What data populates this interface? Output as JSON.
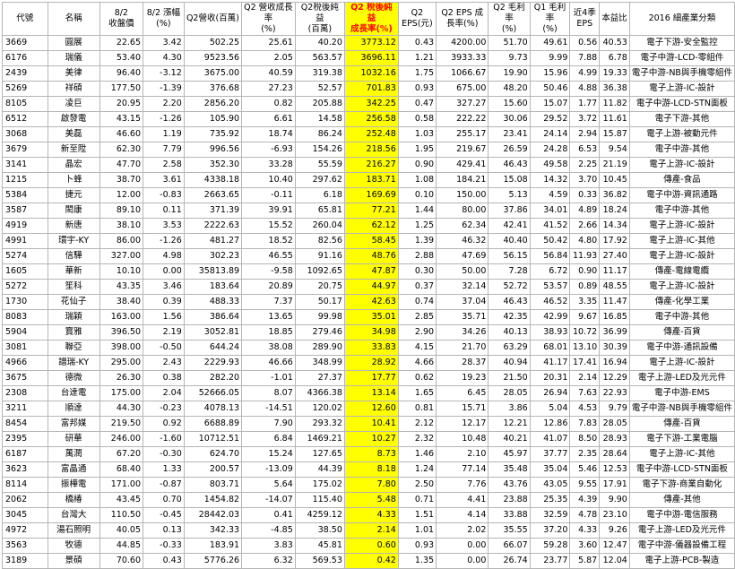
{
  "table": {
    "headers": [
      "代號",
      "名稱",
      "8/2\n收盤價",
      "8/2 漲幅\n(%)",
      "Q2營收(百萬)",
      "Q2 營收成長率\n(%)",
      "Q2稅後純益\n(百萬)",
      "Q2 稅後純益\n成長率(%)",
      "Q2\nEPS(元)",
      "Q2 EPS 成\n長率(%)",
      "Q2 毛利率\n(%)",
      "Q1 毛利率\n(%)",
      "近4季\nEPS",
      "本益比",
      "2016 細產業分類"
    ],
    "rows": [
      [
        "3669",
        "圓展",
        "22.65",
        "3.42",
        "502.25",
        "25.61",
        "40.20",
        "3773.12",
        "0.43",
        "4200.00",
        "51.70",
        "49.61",
        "0.56",
        "40.53",
        "電子下游-安全監控"
      ],
      [
        "6176",
        "瑞儀",
        "53.40",
        "4.30",
        "9523.56",
        "2.05",
        "563.57",
        "3696.11",
        "1.21",
        "3933.33",
        "9.73",
        "9.99",
        "7.88",
        "6.78",
        "電子中游-LCD-零組件"
      ],
      [
        "2439",
        "美律",
        "96.40",
        "-3.12",
        "3675.00",
        "40.59",
        "319.38",
        "1032.16",
        "1.75",
        "1066.67",
        "19.90",
        "15.96",
        "4.99",
        "19.33",
        "電子中游-NB與手機零組件"
      ],
      [
        "5269",
        "祥碩",
        "177.50",
        "-1.39",
        "376.68",
        "27.23",
        "52.57",
        "701.83",
        "0.93",
        "675.00",
        "48.20",
        "50.46",
        "4.88",
        "36.38",
        "電子上游-IC-設計"
      ],
      [
        "8105",
        "凌巨",
        "20.95",
        "2.20",
        "2856.20",
        "0.82",
        "205.88",
        "342.25",
        "0.47",
        "327.27",
        "15.60",
        "15.07",
        "1.77",
        "11.82",
        "電子中游-LCD-STN面板"
      ],
      [
        "6512",
        "啟發電",
        "43.15",
        "-1.26",
        "105.90",
        "6.61",
        "14.58",
        "256.58",
        "0.58",
        "222.22",
        "30.06",
        "29.52",
        "3.72",
        "11.61",
        "電子下游-其他"
      ],
      [
        "3068",
        "美磊",
        "46.60",
        "1.19",
        "735.92",
        "18.74",
        "86.24",
        "252.48",
        "1.03",
        "255.17",
        "23.41",
        "24.14",
        "2.94",
        "15.87",
        "電子上游-被動元件"
      ],
      [
        "3679",
        "新至陞",
        "62.30",
        "7.79",
        "996.56",
        "-6.93",
        "154.26",
        "218.56",
        "1.95",
        "219.67",
        "26.59",
        "24.28",
        "6.53",
        "9.54",
        "電子中游-其他"
      ],
      [
        "3141",
        "晶宏",
        "47.70",
        "2.58",
        "352.30",
        "33.28",
        "55.59",
        "216.27",
        "0.90",
        "429.41",
        "46.43",
        "49.58",
        "2.25",
        "21.19",
        "電子上游-IC-設計"
      ],
      [
        "1215",
        "卜蜂",
        "38.70",
        "3.61",
        "4338.18",
        "10.40",
        "297.62",
        "183.71",
        "1.08",
        "184.21",
        "15.08",
        "14.32",
        "3.70",
        "10.45",
        "傳產-食品"
      ],
      [
        "5384",
        "捷元",
        "12.00",
        "-0.83",
        "2663.65",
        "-0.11",
        "6.18",
        "169.69",
        "0.10",
        "150.00",
        "5.13",
        "4.59",
        "0.33",
        "36.82",
        "電子中游-資訊通路"
      ],
      [
        "3587",
        "閎康",
        "89.10",
        "0.11",
        "371.39",
        "39.91",
        "65.81",
        "77.21",
        "1.44",
        "80.00",
        "37.86",
        "34.01",
        "4.89",
        "18.24",
        "電子中游-其他"
      ],
      [
        "4919",
        "新唐",
        "38.10",
        "3.53",
        "2222.63",
        "15.52",
        "260.04",
        "62.12",
        "1.25",
        "62.34",
        "42.41",
        "41.52",
        "2.66",
        "14.34",
        "電子上游-IC-設計"
      ],
      [
        "4991",
        "環宇-KY",
        "86.00",
        "-1.26",
        "481.27",
        "18.52",
        "82.56",
        "58.45",
        "1.39",
        "46.32",
        "40.40",
        "50.42",
        "4.80",
        "17.92",
        "電子上游-IC-其他"
      ],
      [
        "5274",
        "信驊",
        "327.00",
        "4.98",
        "302.23",
        "46.55",
        "91.16",
        "48.76",
        "2.88",
        "47.69",
        "56.15",
        "56.84",
        "11.93",
        "27.40",
        "電子上游-IC-設計"
      ],
      [
        "1605",
        "華新",
        "10.10",
        "0.00",
        "35813.89",
        "-9.58",
        "1092.65",
        "47.87",
        "0.30",
        "50.00",
        "7.28",
        "6.72",
        "0.90",
        "11.17",
        "傳產-電線電纜"
      ],
      [
        "5272",
        "笙科",
        "43.35",
        "3.46",
        "183.64",
        "20.89",
        "20.75",
        "44.97",
        "0.37",
        "32.14",
        "52.72",
        "53.57",
        "0.89",
        "48.55",
        "電子上游-IC-設計"
      ],
      [
        "1730",
        "花仙子",
        "38.40",
        "0.39",
        "488.33",
        "7.37",
        "50.17",
        "42.63",
        "0.74",
        "37.04",
        "46.43",
        "46.52",
        "3.35",
        "11.47",
        "傳產-化學工業"
      ],
      [
        "8083",
        "瑞穎",
        "163.00",
        "1.56",
        "386.64",
        "13.65",
        "99.98",
        "35.01",
        "2.85",
        "35.71",
        "42.35",
        "42.99",
        "9.67",
        "16.85",
        "電子中游-其他"
      ],
      [
        "5904",
        "寶雅",
        "396.50",
        "2.19",
        "3052.81",
        "18.85",
        "279.46",
        "34.98",
        "2.90",
        "34.26",
        "40.13",
        "38.93",
        "10.72",
        "36.99",
        "傳產-百貨"
      ],
      [
        "3081",
        "聯亞",
        "398.00",
        "-0.50",
        "644.24",
        "38.08",
        "289.90",
        "33.83",
        "4.15",
        "21.70",
        "63.29",
        "68.01",
        "13.10",
        "30.39",
        "電子中游-通訊設備"
      ],
      [
        "4966",
        "譜瑞-KY",
        "295.00",
        "2.43",
        "2229.93",
        "46.66",
        "348.99",
        "28.92",
        "4.66",
        "28.37",
        "40.94",
        "41.17",
        "17.41",
        "16.94",
        "電子上游-IC-設計"
      ],
      [
        "3675",
        "德微",
        "26.30",
        "0.38",
        "282.20",
        "-1.01",
        "27.37",
        "17.77",
        "0.62",
        "19.23",
        "21.50",
        "20.31",
        "2.14",
        "12.29",
        "電子上游-LED及光元件"
      ],
      [
        "2308",
        "台達電",
        "175.00",
        "2.04",
        "52666.05",
        "8.07",
        "4366.38",
        "13.14",
        "1.65",
        "6.45",
        "28.05",
        "26.94",
        "7.63",
        "22.93",
        "電子中游-EMS"
      ],
      [
        "3211",
        "順達",
        "44.30",
        "-0.23",
        "4078.13",
        "-14.51",
        "120.02",
        "12.60",
        "0.81",
        "15.71",
        "3.86",
        "5.04",
        "4.53",
        "9.79",
        "電子中游-NB與手機零組件"
      ],
      [
        "8454",
        "富邦媒",
        "219.50",
        "0.92",
        "6688.89",
        "7.90",
        "293.32",
        "10.41",
        "2.12",
        "12.17",
        "12.21",
        "12.86",
        "7.83",
        "28.05",
        "傳產-百貨"
      ],
      [
        "2395",
        "研華",
        "246.00",
        "-1.60",
        "10712.51",
        "6.84",
        "1469.21",
        "10.27",
        "2.32",
        "10.48",
        "40.21",
        "41.07",
        "8.50",
        "28.93",
        "電子下游-工業電腦"
      ],
      [
        "6187",
        "萬潤",
        "67.20",
        "-0.30",
        "624.70",
        "15.24",
        "127.65",
        "8.73",
        "1.46",
        "2.10",
        "45.97",
        "37.77",
        "2.35",
        "28.64",
        "電子上游-IC-其他"
      ],
      [
        "3623",
        "富晶通",
        "68.40",
        "1.33",
        "200.57",
        "-13.09",
        "44.39",
        "8.18",
        "1.24",
        "77.14",
        "35.48",
        "35.04",
        "5.46",
        "12.53",
        "電子中游-LCD-STN面板"
      ],
      [
        "8114",
        "振樺電",
        "171.00",
        "-0.87",
        "803.71",
        "5.64",
        "175.02",
        "7.80",
        "2.50",
        "7.76",
        "43.76",
        "43.05",
        "9.55",
        "17.91",
        "電子下游-商業自動化"
      ],
      [
        "2062",
        "橋椿",
        "43.45",
        "0.70",
        "1454.82",
        "-14.07",
        "115.40",
        "5.48",
        "0.71",
        "4.41",
        "23.88",
        "25.35",
        "4.39",
        "9.90",
        "傳產-其他"
      ],
      [
        "3045",
        "台灣大",
        "110.50",
        "-0.45",
        "28442.03",
        "0.41",
        "4259.12",
        "4.33",
        "1.51",
        "4.14",
        "33.88",
        "32.59",
        "4.78",
        "23.10",
        "電子中游-電信服務"
      ],
      [
        "4972",
        "湯石照明",
        "40.05",
        "0.13",
        "342.33",
        "-4.85",
        "38.50",
        "2.14",
        "1.01",
        "2.02",
        "35.55",
        "37.20",
        "4.33",
        "9.26",
        "電子上游-LED及光元件"
      ],
      [
        "3563",
        "牧德",
        "44.85",
        "-0.33",
        "183.91",
        "3.83",
        "45.81",
        "0.60",
        "0.93",
        "0.00",
        "66.07",
        "59.28",
        "3.60",
        "12.47",
        "電子中游-儀器設備工程"
      ],
      [
        "3189",
        "景碩",
        "70.60",
        "0.43",
        "5776.26",
        "6.32",
        "569.53",
        "0.42",
        "1.35",
        "0.00",
        "26.74",
        "23.77",
        "5.87",
        "12.04",
        "電子上游-PCB-製造"
      ]
    ]
  }
}
